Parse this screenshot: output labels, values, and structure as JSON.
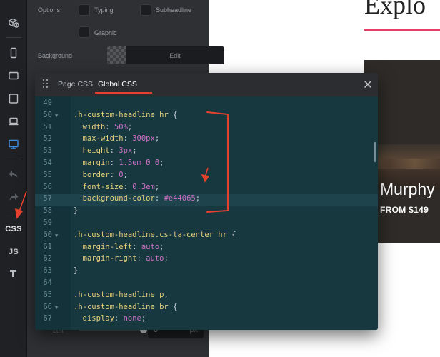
{
  "inspector": {
    "options_label": "Options",
    "typing_label": "Typing",
    "subheadline_label": "Subheadline",
    "graphic_label": "Graphic",
    "background_label": "Background",
    "edit_label": "Edit",
    "left_label": "Left",
    "left_value": "0",
    "left_unit": "px"
  },
  "toolbar": {
    "css_label": "CSS",
    "js_label": "JS"
  },
  "modal": {
    "tabs": [
      "Page CSS",
      "Global CSS"
    ],
    "active_tab": "Global CSS",
    "accent_color": "#e4412e",
    "lines": [
      {
        "n": "49",
        "text": ""
      },
      {
        "n": "50",
        "text": ".h-custom-headline hr {",
        "fold": true
      },
      {
        "n": "51",
        "text": "  width: 50%;"
      },
      {
        "n": "52",
        "text": "  max-width: 300px;"
      },
      {
        "n": "53",
        "text": "  height: 3px;"
      },
      {
        "n": "54",
        "text": "  margin: 1.5em 0 0;"
      },
      {
        "n": "55",
        "text": "  border: 0;"
      },
      {
        "n": "56",
        "text": "  font-size: 0.3em;"
      },
      {
        "n": "57",
        "text": "  background-color: #e44065;",
        "highlight": true
      },
      {
        "n": "58",
        "text": "}"
      },
      {
        "n": "59",
        "text": ""
      },
      {
        "n": "60",
        "text": ".h-custom-headline.cs-ta-center hr {",
        "fold": true
      },
      {
        "n": "61",
        "text": "  margin-left: auto;"
      },
      {
        "n": "62",
        "text": "  margin-right: auto;"
      },
      {
        "n": "63",
        "text": "}"
      },
      {
        "n": "64",
        "text": ""
      },
      {
        "n": "65",
        "text": ".h-custom-headline p,"
      },
      {
        "n": "66",
        "text": ".h-custom-headline br {",
        "fold": true
      },
      {
        "n": "67",
        "text": "  display: none;"
      }
    ]
  },
  "preview": {
    "heading_partial": "Explo",
    "accent_line_color": "#e44065",
    "card_title": "Murphy",
    "card_price": "FROM $149"
  },
  "colors": {
    "annotation_red": "#e4412e",
    "editor_bg": "#183840"
  }
}
